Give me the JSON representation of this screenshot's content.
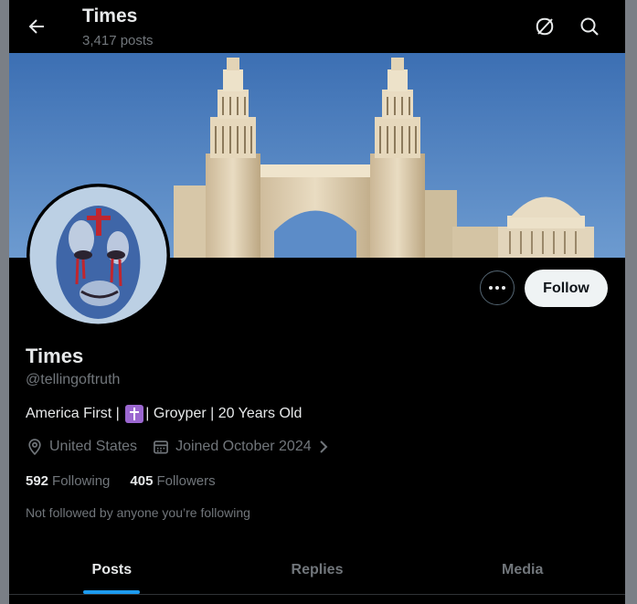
{
  "header": {
    "title": "Times",
    "post_count": "3,417 posts",
    "icons": [
      "back-arrow-icon",
      "grok-icon",
      "search-icon"
    ]
  },
  "profile": {
    "display_name": "Times",
    "handle": "@tellingoftruth",
    "bio_prefix": "America First | ",
    "bio_emoji": "latin-cross-emoji",
    "bio_suffix": "| Groyper | 20 Years Old",
    "location": "United States",
    "joined": "Joined October 2024",
    "following_count": "592",
    "following_label": "Following",
    "followers_count": "405",
    "followers_label": "Followers",
    "followed_by_notice": "Not followed by anyone you’re following"
  },
  "actions": {
    "follow_label": "Follow"
  },
  "tabs": [
    {
      "label": "Posts",
      "active": true
    },
    {
      "label": "Replies",
      "active": false
    },
    {
      "label": "Media",
      "active": false
    }
  ],
  "colors": {
    "background": "#000000",
    "accent": "#1d9bf0",
    "muted_text": "#71767b",
    "follow_button": "#eff3f4",
    "sky": "#4a7fc0"
  }
}
